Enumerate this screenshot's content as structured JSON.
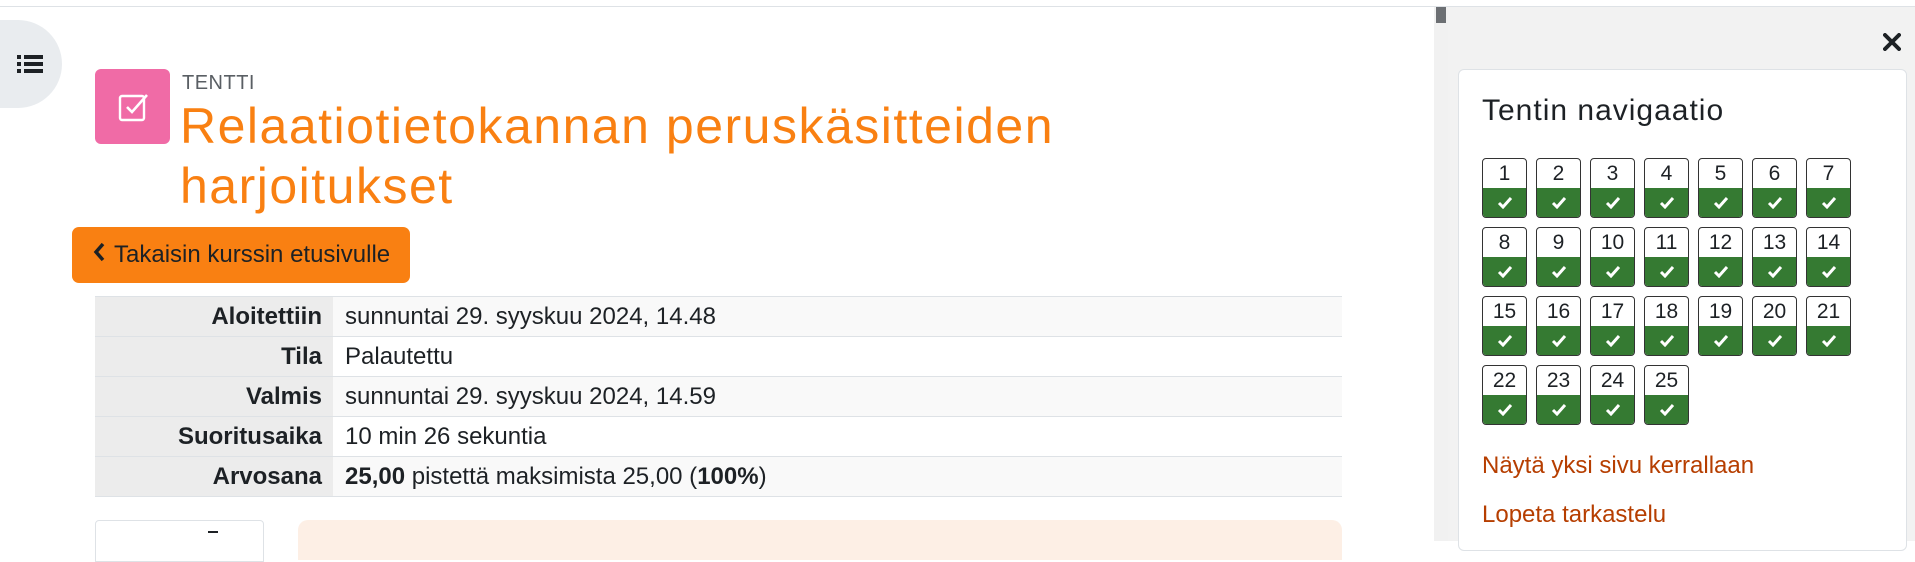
{
  "activity": {
    "type_label": "TENTTI",
    "title": "Relaatiotietokannan peruskäsitteiden harjoitukset",
    "back_label": "Takaisin kurssin etusivulle",
    "icon": "quiz-checkbox-icon",
    "accent_color": "#f98012",
    "icon_bg_color": "#f06ba6"
  },
  "summary": {
    "rows": [
      {
        "label": "Aloitettiin",
        "value": "sunnuntai 29. syyskuu 2024, 14.48"
      },
      {
        "label": "Tila",
        "value": "Palautettu"
      },
      {
        "label": "Valmis",
        "value": "sunnuntai 29. syyskuu 2024, 14.59"
      },
      {
        "label": "Suoritusaika",
        "value": "10 min 26 sekuntia"
      }
    ],
    "grade": {
      "label": "Arvosana",
      "score": "25,00",
      "middle": " pistettä maksimista 25,00 (",
      "percent": "100%",
      "end": ")"
    }
  },
  "drawer": {
    "title": "Tentin navigaatio",
    "questions": [
      "1",
      "2",
      "3",
      "4",
      "5",
      "6",
      "7",
      "8",
      "9",
      "10",
      "11",
      "12",
      "13",
      "14",
      "15",
      "16",
      "17",
      "18",
      "19",
      "20",
      "21",
      "22",
      "23",
      "24",
      "25"
    ],
    "question_state": "correct",
    "state_color": "#357a32",
    "links": {
      "one_page": "Näytä yksi sivu kerrallaan",
      "finish_review": "Lopeta tarkastelu"
    },
    "link_color": "#b63e00"
  },
  "icons": {
    "drawer_toggle": "list-icon",
    "close": "close-icon",
    "back": "chevron-left-icon",
    "question_state": "check-icon"
  }
}
